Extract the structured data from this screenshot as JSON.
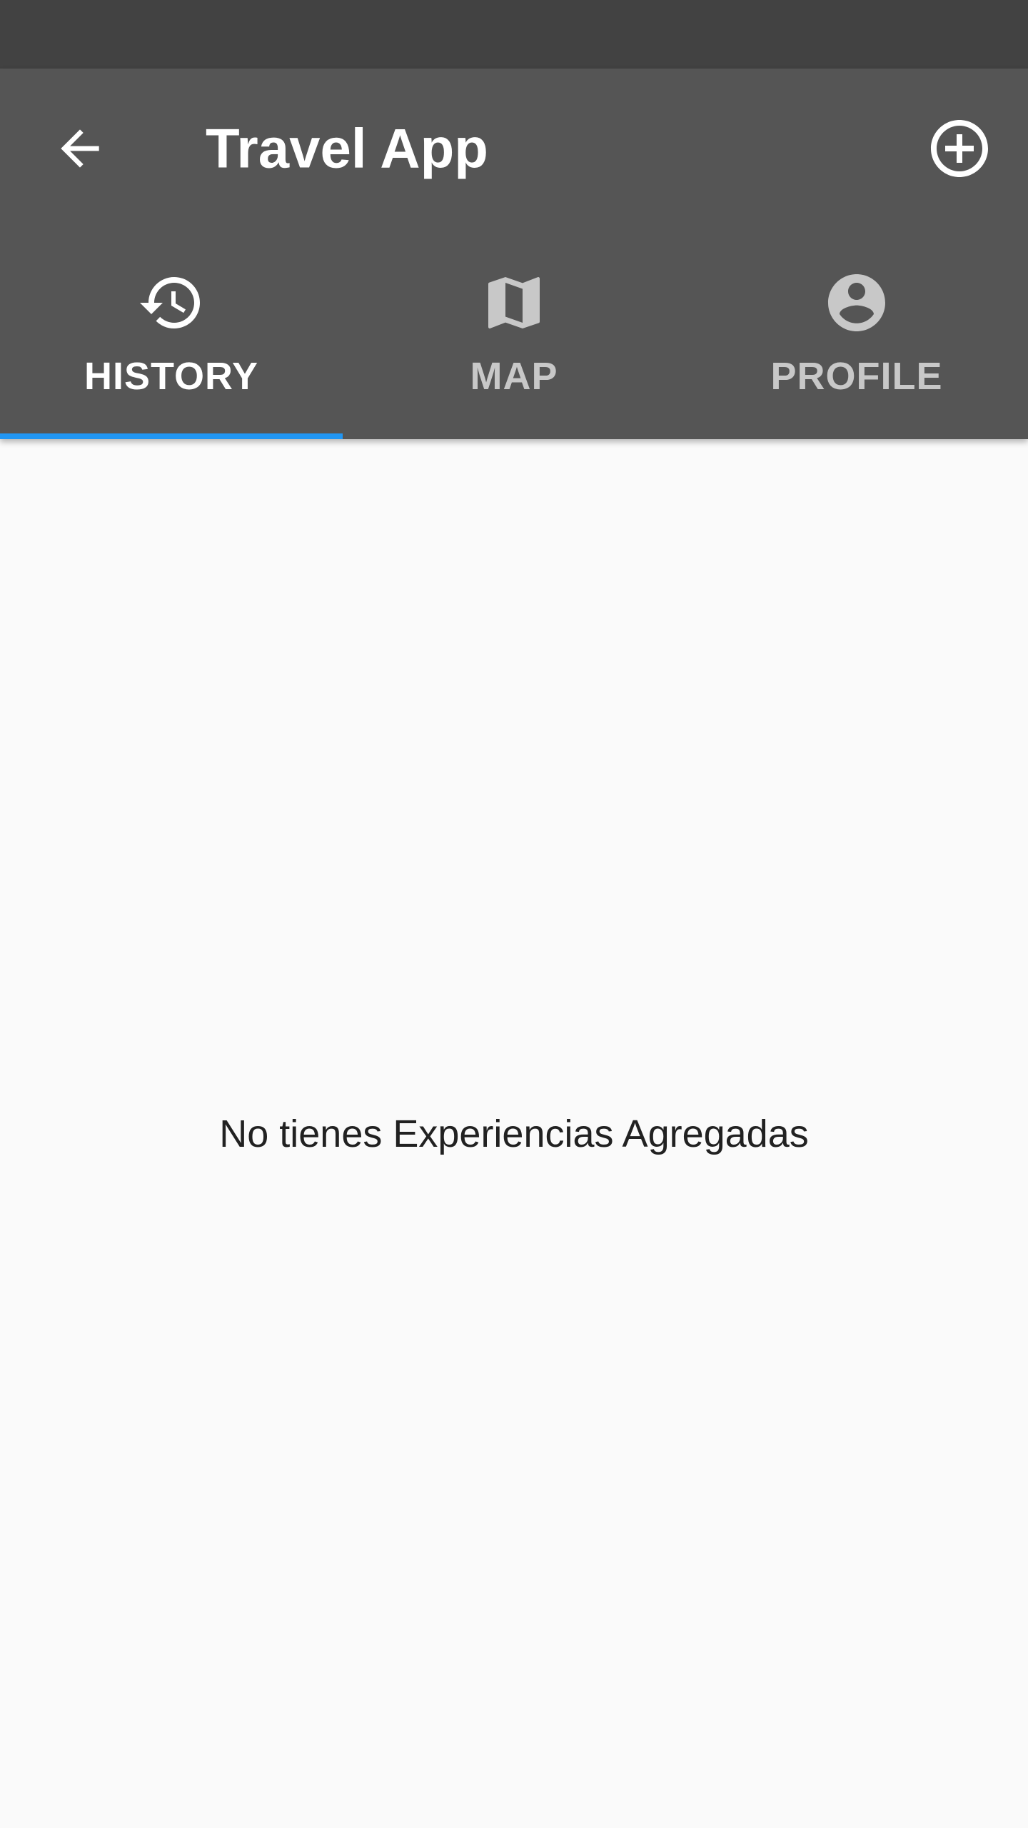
{
  "app_bar": {
    "title": "Travel App",
    "back_icon": "arrow-back-icon",
    "add_icon": "add-circle-outline-icon"
  },
  "tabs": [
    {
      "label": "HISTORY",
      "icon": "history-icon",
      "selected": true
    },
    {
      "label": "MAP",
      "icon": "map-icon",
      "selected": false
    },
    {
      "label": "PROFILE",
      "icon": "account-circle-icon",
      "selected": false
    }
  ],
  "content": {
    "empty_message": "No tienes Experiencias Agregadas"
  },
  "colors": {
    "status_bar": "#424242",
    "app_bar": "#555555",
    "tab_indicator": "#2196f3",
    "background": "#fafafa",
    "active_text": "#ffffff",
    "inactive_text": "#c8c8c8"
  }
}
